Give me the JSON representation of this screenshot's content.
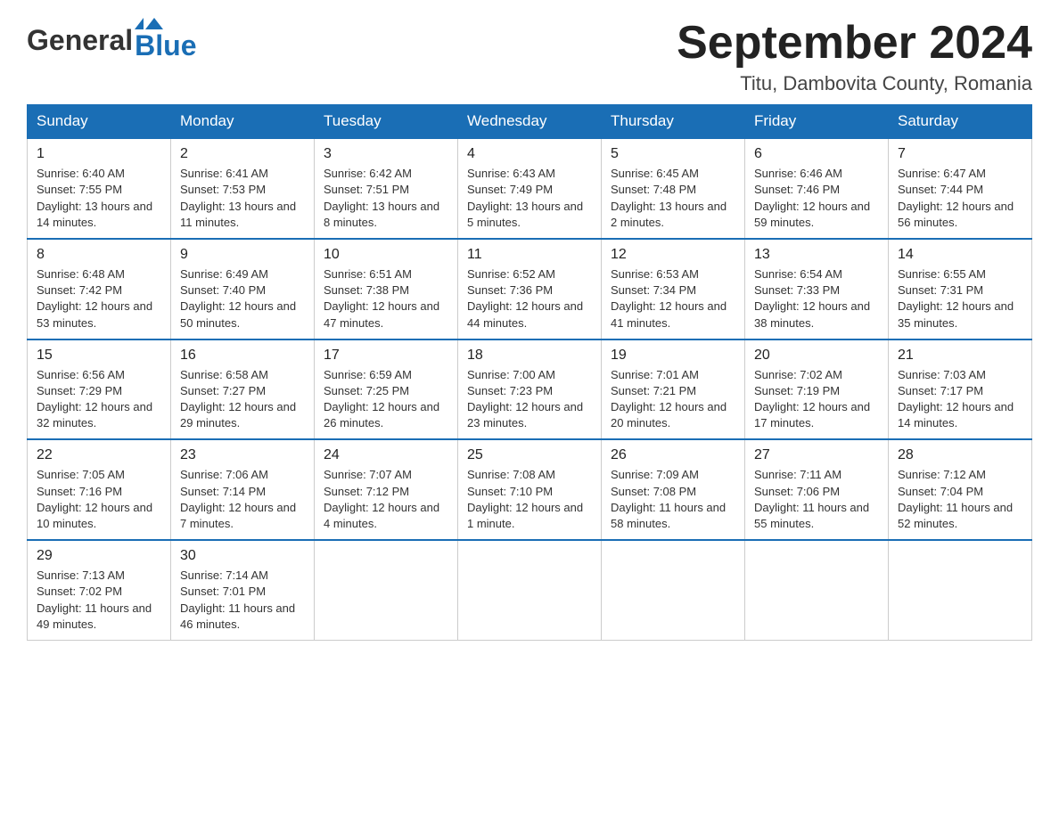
{
  "header": {
    "logo_general": "General",
    "logo_blue": "Blue",
    "month_title": "September 2024",
    "location": "Titu, Dambovita County, Romania"
  },
  "weekdays": [
    "Sunday",
    "Monday",
    "Tuesday",
    "Wednesday",
    "Thursday",
    "Friday",
    "Saturday"
  ],
  "weeks": [
    [
      {
        "day": "1",
        "sunrise": "Sunrise: 6:40 AM",
        "sunset": "Sunset: 7:55 PM",
        "daylight": "Daylight: 13 hours and 14 minutes."
      },
      {
        "day": "2",
        "sunrise": "Sunrise: 6:41 AM",
        "sunset": "Sunset: 7:53 PM",
        "daylight": "Daylight: 13 hours and 11 minutes."
      },
      {
        "day": "3",
        "sunrise": "Sunrise: 6:42 AM",
        "sunset": "Sunset: 7:51 PM",
        "daylight": "Daylight: 13 hours and 8 minutes."
      },
      {
        "day": "4",
        "sunrise": "Sunrise: 6:43 AM",
        "sunset": "Sunset: 7:49 PM",
        "daylight": "Daylight: 13 hours and 5 minutes."
      },
      {
        "day": "5",
        "sunrise": "Sunrise: 6:45 AM",
        "sunset": "Sunset: 7:48 PM",
        "daylight": "Daylight: 13 hours and 2 minutes."
      },
      {
        "day": "6",
        "sunrise": "Sunrise: 6:46 AM",
        "sunset": "Sunset: 7:46 PM",
        "daylight": "Daylight: 12 hours and 59 minutes."
      },
      {
        "day": "7",
        "sunrise": "Sunrise: 6:47 AM",
        "sunset": "Sunset: 7:44 PM",
        "daylight": "Daylight: 12 hours and 56 minutes."
      }
    ],
    [
      {
        "day": "8",
        "sunrise": "Sunrise: 6:48 AM",
        "sunset": "Sunset: 7:42 PM",
        "daylight": "Daylight: 12 hours and 53 minutes."
      },
      {
        "day": "9",
        "sunrise": "Sunrise: 6:49 AM",
        "sunset": "Sunset: 7:40 PM",
        "daylight": "Daylight: 12 hours and 50 minutes."
      },
      {
        "day": "10",
        "sunrise": "Sunrise: 6:51 AM",
        "sunset": "Sunset: 7:38 PM",
        "daylight": "Daylight: 12 hours and 47 minutes."
      },
      {
        "day": "11",
        "sunrise": "Sunrise: 6:52 AM",
        "sunset": "Sunset: 7:36 PM",
        "daylight": "Daylight: 12 hours and 44 minutes."
      },
      {
        "day": "12",
        "sunrise": "Sunrise: 6:53 AM",
        "sunset": "Sunset: 7:34 PM",
        "daylight": "Daylight: 12 hours and 41 minutes."
      },
      {
        "day": "13",
        "sunrise": "Sunrise: 6:54 AM",
        "sunset": "Sunset: 7:33 PM",
        "daylight": "Daylight: 12 hours and 38 minutes."
      },
      {
        "day": "14",
        "sunrise": "Sunrise: 6:55 AM",
        "sunset": "Sunset: 7:31 PM",
        "daylight": "Daylight: 12 hours and 35 minutes."
      }
    ],
    [
      {
        "day": "15",
        "sunrise": "Sunrise: 6:56 AM",
        "sunset": "Sunset: 7:29 PM",
        "daylight": "Daylight: 12 hours and 32 minutes."
      },
      {
        "day": "16",
        "sunrise": "Sunrise: 6:58 AM",
        "sunset": "Sunset: 7:27 PM",
        "daylight": "Daylight: 12 hours and 29 minutes."
      },
      {
        "day": "17",
        "sunrise": "Sunrise: 6:59 AM",
        "sunset": "Sunset: 7:25 PM",
        "daylight": "Daylight: 12 hours and 26 minutes."
      },
      {
        "day": "18",
        "sunrise": "Sunrise: 7:00 AM",
        "sunset": "Sunset: 7:23 PM",
        "daylight": "Daylight: 12 hours and 23 minutes."
      },
      {
        "day": "19",
        "sunrise": "Sunrise: 7:01 AM",
        "sunset": "Sunset: 7:21 PM",
        "daylight": "Daylight: 12 hours and 20 minutes."
      },
      {
        "day": "20",
        "sunrise": "Sunrise: 7:02 AM",
        "sunset": "Sunset: 7:19 PM",
        "daylight": "Daylight: 12 hours and 17 minutes."
      },
      {
        "day": "21",
        "sunrise": "Sunrise: 7:03 AM",
        "sunset": "Sunset: 7:17 PM",
        "daylight": "Daylight: 12 hours and 14 minutes."
      }
    ],
    [
      {
        "day": "22",
        "sunrise": "Sunrise: 7:05 AM",
        "sunset": "Sunset: 7:16 PM",
        "daylight": "Daylight: 12 hours and 10 minutes."
      },
      {
        "day": "23",
        "sunrise": "Sunrise: 7:06 AM",
        "sunset": "Sunset: 7:14 PM",
        "daylight": "Daylight: 12 hours and 7 minutes."
      },
      {
        "day": "24",
        "sunrise": "Sunrise: 7:07 AM",
        "sunset": "Sunset: 7:12 PM",
        "daylight": "Daylight: 12 hours and 4 minutes."
      },
      {
        "day": "25",
        "sunrise": "Sunrise: 7:08 AM",
        "sunset": "Sunset: 7:10 PM",
        "daylight": "Daylight: 12 hours and 1 minute."
      },
      {
        "day": "26",
        "sunrise": "Sunrise: 7:09 AM",
        "sunset": "Sunset: 7:08 PM",
        "daylight": "Daylight: 11 hours and 58 minutes."
      },
      {
        "day": "27",
        "sunrise": "Sunrise: 7:11 AM",
        "sunset": "Sunset: 7:06 PM",
        "daylight": "Daylight: 11 hours and 55 minutes."
      },
      {
        "day": "28",
        "sunrise": "Sunrise: 7:12 AM",
        "sunset": "Sunset: 7:04 PM",
        "daylight": "Daylight: 11 hours and 52 minutes."
      }
    ],
    [
      {
        "day": "29",
        "sunrise": "Sunrise: 7:13 AM",
        "sunset": "Sunset: 7:02 PM",
        "daylight": "Daylight: 11 hours and 49 minutes."
      },
      {
        "day": "30",
        "sunrise": "Sunrise: 7:14 AM",
        "sunset": "Sunset: 7:01 PM",
        "daylight": "Daylight: 11 hours and 46 minutes."
      },
      null,
      null,
      null,
      null,
      null
    ]
  ]
}
